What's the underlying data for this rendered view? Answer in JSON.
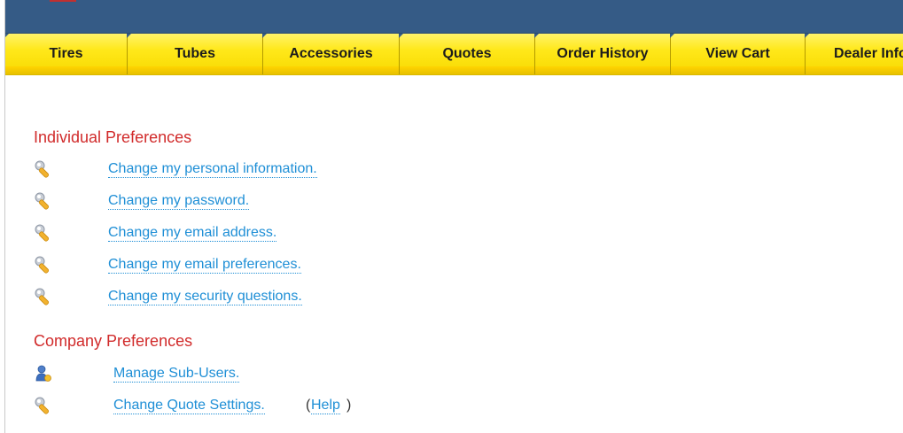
{
  "nav": {
    "tabs": [
      {
        "label": "Tires",
        "width": 138
      },
      {
        "label": "Tubes",
        "width": 153
      },
      {
        "label": "Accessories",
        "width": 154
      },
      {
        "label": "Quotes",
        "width": 153
      },
      {
        "label": "Order History",
        "width": 153
      },
      {
        "label": "View Cart",
        "width": 152
      },
      {
        "label": "Dealer Info",
        "width": 120
      }
    ]
  },
  "individual": {
    "title": "Individual Preferences",
    "links": [
      "Change my personal information.",
      "Change my password.",
      "Change my email address.",
      "Change my email preferences.",
      "Change my security questions."
    ]
  },
  "company": {
    "title": "Company Preferences",
    "manage_sub_users": "Manage Sub-Users.",
    "change_quote_settings": "Change Quote Settings.",
    "help_open": "(",
    "help": "Help",
    "help_close": ")"
  },
  "colors": {
    "header": "#355b86",
    "nav_yellow": "#ffe81a",
    "section_title": "#d12b2b",
    "link": "#1f8fd6"
  },
  "icons": {
    "wrench": "wrench-icon",
    "user": "user-icon"
  }
}
